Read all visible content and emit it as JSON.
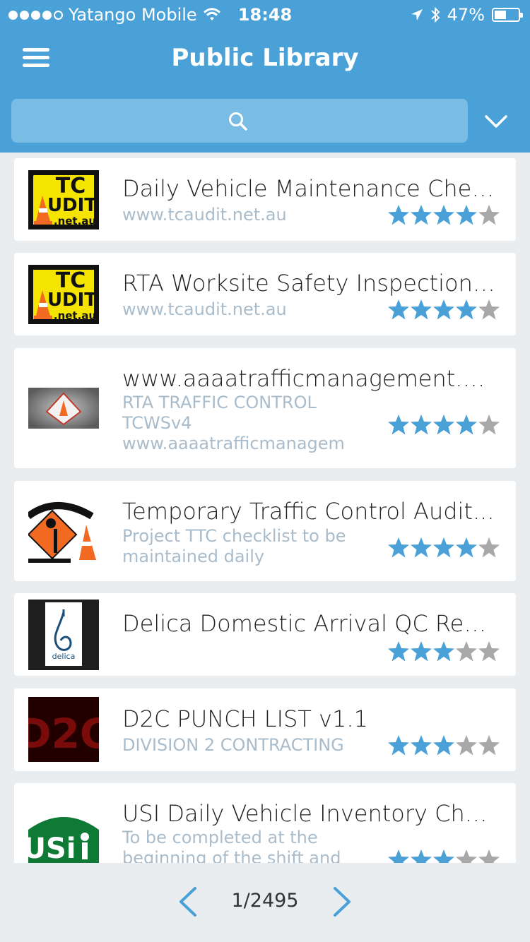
{
  "status_bar": {
    "carrier": "Yatango Mobile",
    "time": "18:48",
    "battery": "47%"
  },
  "header": {
    "title": "Public Library",
    "search_placeholder": ""
  },
  "items": [
    {
      "title": "Daily Vehicle Maintenance Chec...",
      "subtitle": [
        "www.tcaudit.net.au"
      ],
      "rating": 4,
      "logo": "tcaudit-logo"
    },
    {
      "title": "RTA Worksite Safety Inspection T...",
      "subtitle": [
        "www.tcaudit.net.au"
      ],
      "rating": 4,
      "logo": "tcaudit-logo"
    },
    {
      "title": "www.aaaatrafficmanagement.co...",
      "subtitle": [
        "RTA TRAFFIC CONTROL",
        "TCWSv4",
        "www.aaaatrafficmanagem"
      ],
      "rating": 4,
      "logo": "aaaa-traffic-logo"
    },
    {
      "title": "Temporary Traffic Control Audit...",
      "subtitle": [
        "Project TTC checklist to be",
        "maintained daily"
      ],
      "rating": 4,
      "logo": "flag-safe-logo"
    },
    {
      "title": "Delica Domestic Arrival QC Repo...",
      "subtitle": [],
      "rating": 3,
      "logo": "delica-logo"
    },
    {
      "title": "D2C PUNCH LIST v1.1",
      "subtitle": [
        "DIVISION 2 CONTRACTING"
      ],
      "rating": 3,
      "logo": "d2c-logo"
    },
    {
      "title": "USI Daily Vehicle Inventory Chec...",
      "subtitle": [
        "To be completed at the",
        "beginning of the shift and"
      ],
      "rating": 3,
      "logo": "usi-logo"
    }
  ],
  "logo_text": {
    "tcaudit_a": "TC",
    "tcaudit_b": "UDIT",
    "tcaudit_c": ".net.au",
    "d2c": "D2C",
    "usi": "USi",
    "delica": "delica"
  },
  "pager": {
    "label": "1/2495"
  },
  "colors": {
    "header": "#4aa1d8",
    "star_on": "#4aa1d8",
    "star_off": "#a8a8a8",
    "subtitle": "#a9bccb"
  }
}
